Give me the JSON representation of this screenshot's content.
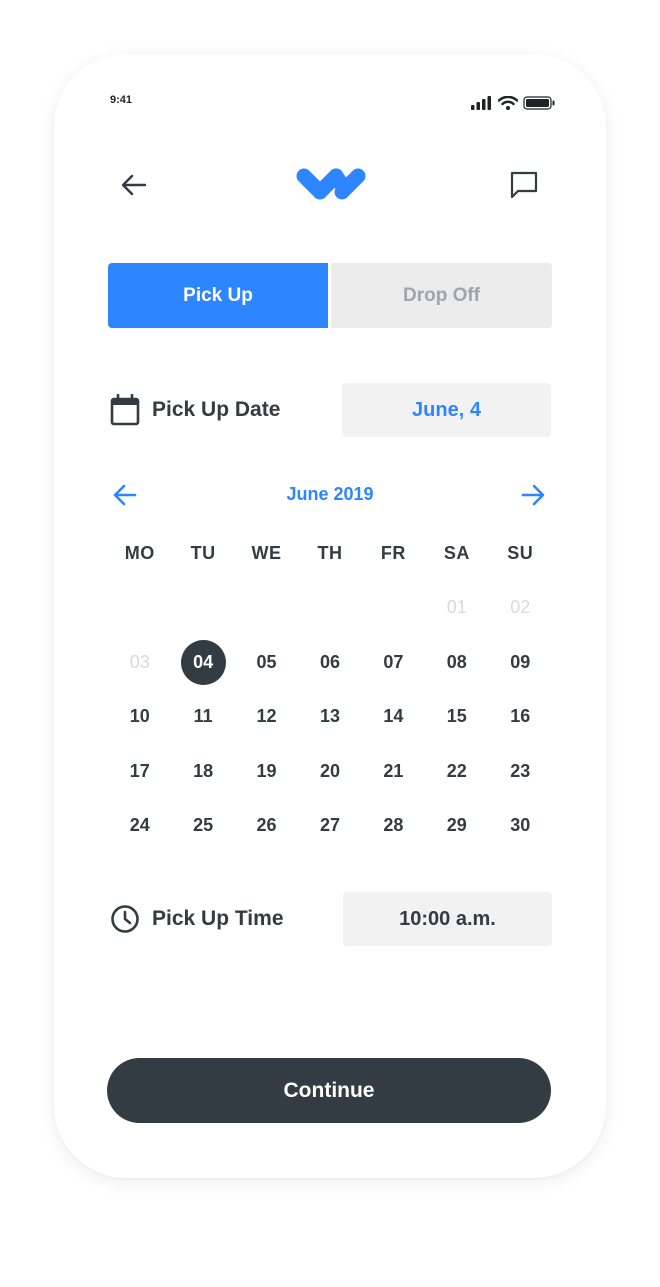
{
  "status_bar": {
    "time": "9:41"
  },
  "brand": {
    "accent": "#2d86ff",
    "dark": "#323c42"
  },
  "icons": {
    "back": "arrow-left-icon",
    "logo": "brand-logo",
    "chat": "chat-bubble-icon",
    "calendar": "calendar-icon",
    "clock": "clock-icon",
    "prev_month": "arrow-left-icon",
    "next_month": "arrow-right-icon"
  },
  "segments": {
    "pickup": "Pick Up",
    "dropoff": "Drop Off",
    "selected": "pickup"
  },
  "date_row": {
    "label": "Pick Up Date",
    "value": "June, 4"
  },
  "calendar": {
    "month_label": "June 2019",
    "weekdays": [
      "MO",
      "TU",
      "WE",
      "TH",
      "FR",
      "SA",
      "SU"
    ],
    "weeks": [
      [
        "",
        "",
        "",
        "",
        "",
        "01",
        "02"
      ],
      [
        "03",
        "04",
        "05",
        "06",
        "07",
        "08",
        "09"
      ],
      [
        "10",
        "11",
        "12",
        "13",
        "14",
        "15",
        "16"
      ],
      [
        "17",
        "18",
        "19",
        "20",
        "21",
        "22",
        "23"
      ],
      [
        "24",
        "25",
        "26",
        "27",
        "28",
        "29",
        "30"
      ]
    ],
    "disabled": [
      "01",
      "02",
      "03"
    ],
    "selected": "04"
  },
  "time_row": {
    "label": "Pick Up Time",
    "value": "10:00 a.m."
  },
  "continue_label": "Continue"
}
